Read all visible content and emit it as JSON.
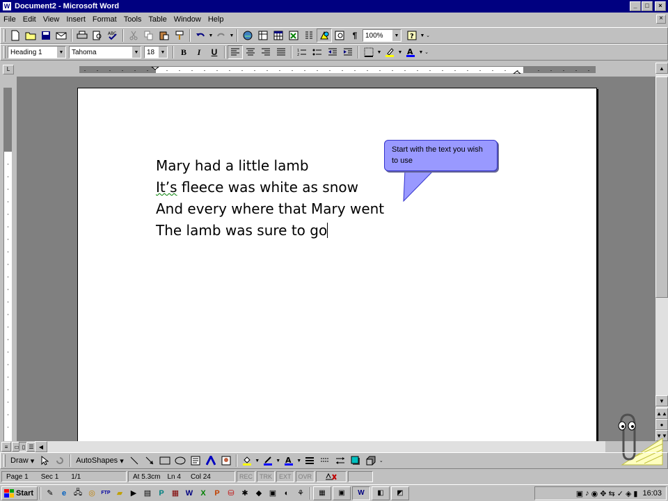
{
  "window": {
    "title": "Document2 - Microsoft Word",
    "app_icon": "W",
    "buttons": [
      "_",
      "□",
      "×"
    ]
  },
  "menu": {
    "items": [
      "File",
      "Edit",
      "View",
      "Insert",
      "Format",
      "Tools",
      "Table",
      "Window",
      "Help"
    ],
    "doc_close": "×"
  },
  "standard_toolbar": {
    "zoom": "100%"
  },
  "formatting_toolbar": {
    "style": "Heading 1",
    "font": "Tahoma",
    "size": "18",
    "bold": "B",
    "italic": "I",
    "underline": "U"
  },
  "document": {
    "lines": [
      "Mary had a little lamb",
      "It’s fleece was white as snow",
      "And every where that Mary went",
      "The lamb was sure to go"
    ],
    "line2_rest": " fleece was white as snow",
    "line2_word": "It’s"
  },
  "callout": {
    "text": "Start with the text you wish to use",
    "color": "#9999ff"
  },
  "drawing_toolbar": {
    "draw": "Draw",
    "autoshapes": "AutoShapes"
  },
  "status": {
    "page": "Page 1",
    "sec": "Sec 1",
    "pages": "1/1",
    "at": "At 5.3cm",
    "ln": "Ln 4",
    "col": "Col 24",
    "rec": "REC",
    "trk": "TRK",
    "ext": "EXT",
    "ovr": "OVR"
  },
  "taskbar": {
    "start": "Start",
    "clock": "16:03"
  }
}
